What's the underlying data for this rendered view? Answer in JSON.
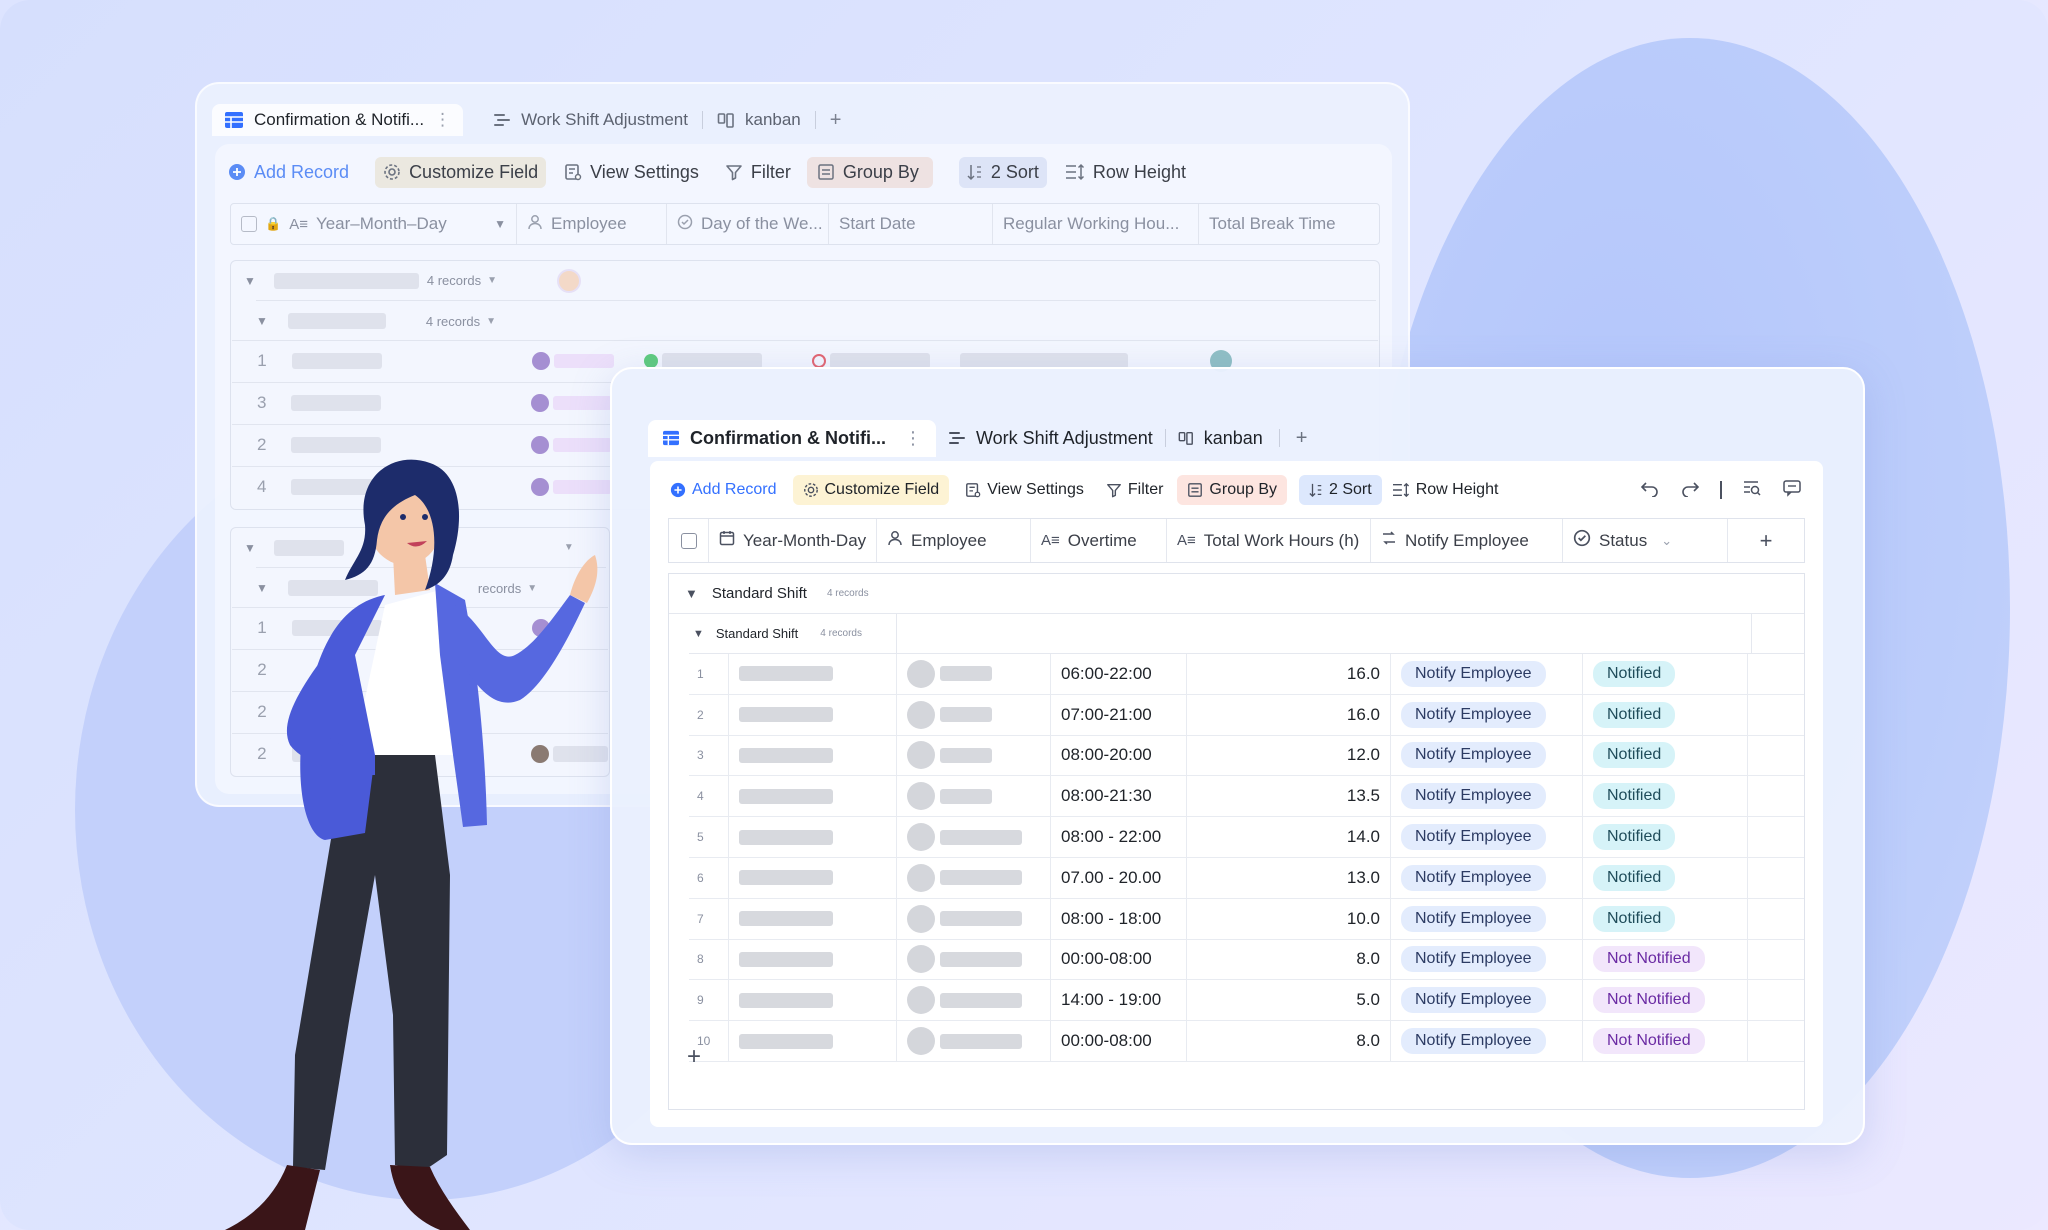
{
  "colors": {
    "accent": "#3370ff",
    "pill_notify_bg": "#e3ecfd",
    "pill_notified_bg": "#d6f3f8",
    "pill_not_notified_bg": "#f2e6fb",
    "customize_field_bg": "#fdf3d4",
    "group_by_bg": "#fde5e0",
    "sort_bg": "#dde8fd"
  },
  "back_window": {
    "tabs": [
      {
        "label": "Confirmation & Notifi...",
        "icon": "grid-table-icon"
      },
      {
        "label": "Work Shift Adjustment",
        "icon": "gantt-icon"
      },
      {
        "label": "kanban",
        "icon": "kanban-icon"
      }
    ],
    "toolbar": {
      "add_record": "Add Record",
      "customize_field": "Customize Field",
      "view_settings": "View Settings",
      "filter": "Filter",
      "group_by": "Group By",
      "sort": "2 Sort",
      "row_height": "Row Height"
    },
    "columns": [
      "Year–Month–Day",
      "Employee",
      "Day of the We...",
      "Start Date",
      "Regular Working Hou...",
      "Total Break Time"
    ],
    "group_counts": [
      "4 records",
      "4 records",
      "4 records",
      "records"
    ],
    "row_numbers_group1": [
      "1",
      "3",
      "2",
      "4"
    ],
    "row_numbers_group2": [
      "1",
      "2",
      "2",
      "2"
    ]
  },
  "front_window": {
    "tabs": [
      {
        "label": "Confirmation & Notifi...",
        "icon": "grid-table-icon"
      },
      {
        "label": "Work Shift Adjustment",
        "icon": "gantt-icon"
      },
      {
        "label": "kanban",
        "icon": "kanban-icon"
      }
    ],
    "add_tab": "+",
    "toolbar": {
      "add_record": "Add Record",
      "customize_field": "Customize Field",
      "view_settings": "View Settings",
      "filter": "Filter",
      "group_by": "Group By",
      "sort": "2 Sort",
      "row_height": "Row Height"
    },
    "columns": {
      "date": "Year-Month-Day",
      "employee": "Employee",
      "overtime": "Overtime",
      "total_hours": "Total Work Hours (h)",
      "notify": "Notify Employee",
      "status": "Status"
    },
    "group": {
      "label": "Standard Shift",
      "count": "4 records"
    },
    "subgroup": {
      "label": "Standard Shift",
      "count": "4 records"
    },
    "rows": [
      {
        "n": "1",
        "overtime": "06:00-22:00",
        "hours": "16.0",
        "notify": "Notify Employee",
        "status": "Notified",
        "state": "notified"
      },
      {
        "n": "2",
        "overtime": "07:00-21:00",
        "hours": "16.0",
        "notify": "Notify Employee",
        "status": "Notified",
        "state": "notified"
      },
      {
        "n": "3",
        "overtime": "08:00-20:00",
        "hours": "12.0",
        "notify": "Notify Employee",
        "status": "Notified",
        "state": "notified"
      },
      {
        "n": "4",
        "overtime": "08:00-21:30",
        "hours": "13.5",
        "notify": "Notify Employee",
        "status": "Notified",
        "state": "notified"
      },
      {
        "n": "5",
        "overtime": "08:00 - 22:00",
        "hours": "14.0",
        "notify": "Notify Employee",
        "status": "Notified",
        "state": "notified"
      },
      {
        "n": "6",
        "overtime": "07.00 - 20.00",
        "hours": "13.0",
        "notify": "Notify Employee",
        "status": "Notified",
        "state": "notified"
      },
      {
        "n": "7",
        "overtime": "08:00 - 18:00",
        "hours": "10.0",
        "notify": "Notify Employee",
        "status": "Notified",
        "state": "notified"
      },
      {
        "n": "8",
        "overtime": "00:00-08:00",
        "hours": "8.0",
        "notify": "Notify Employee",
        "status": "Not Notified",
        "state": "not"
      },
      {
        "n": "9",
        "overtime": "14:00 - 19:00",
        "hours": "5.0",
        "notify": "Notify Employee",
        "status": "Not Notified",
        "state": "not"
      },
      {
        "n": "10",
        "overtime": "00:00-08:00",
        "hours": "8.0",
        "notify": "Notify Employee",
        "status": "Not Notified",
        "state": "not"
      }
    ],
    "add_row": "+"
  }
}
